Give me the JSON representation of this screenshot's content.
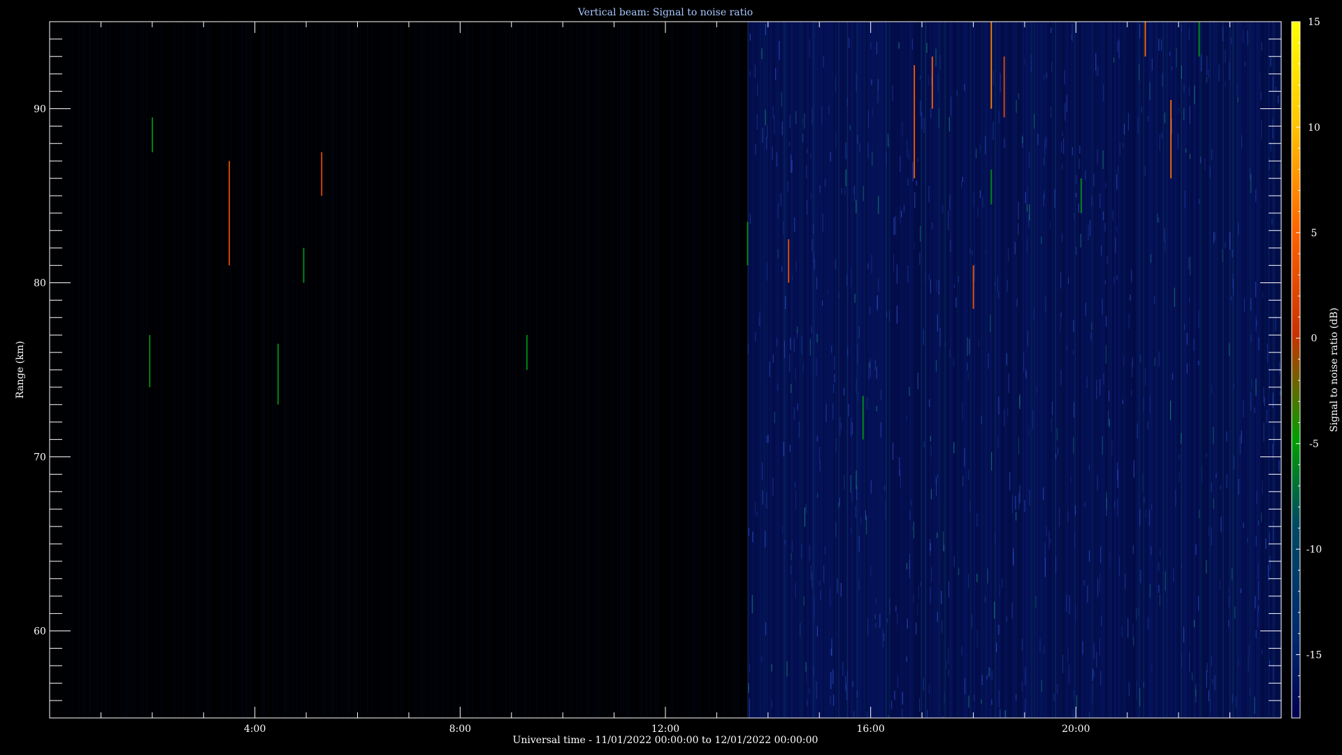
{
  "chart_data": {
    "type": "heatmap",
    "title": "Vertical beam: Signal to noise ratio",
    "xlabel": "Universal time - 11/01/2022 00:00:00 to 12/01/2022 00:00:00",
    "ylabel": "Range (km)",
    "colorbar_label": "Signal to noise ratio (dB)",
    "xlim_hours": [
      0,
      24
    ],
    "ylim_km": [
      55,
      95
    ],
    "clim_db": [
      -18,
      15
    ],
    "x_ticks": [
      {
        "hours": 4,
        "label": "4:00"
      },
      {
        "hours": 8,
        "label": "8:00"
      },
      {
        "hours": 12,
        "label": "12:00"
      },
      {
        "hours": 16,
        "label": "16:00"
      },
      {
        "hours": 20,
        "label": "20:00"
      }
    ],
    "y_ticks": [
      {
        "km": 60,
        "label": "60"
      },
      {
        "km": 70,
        "label": "70"
      },
      {
        "km": 80,
        "label": "80"
      },
      {
        "km": 90,
        "label": "90"
      }
    ],
    "colorbar_ticks": [
      {
        "db": 15,
        "label": "15"
      },
      {
        "db": 10,
        "label": "10"
      },
      {
        "db": 5,
        "label": "5"
      },
      {
        "db": 0,
        "label": "0"
      },
      {
        "db": -5,
        "label": "-5"
      },
      {
        "db": -10,
        "label": "-10"
      },
      {
        "db": -15,
        "label": "-15"
      }
    ],
    "colormap": [
      "#000050",
      "#003278",
      "#006446",
      "#00a000",
      "#c83200",
      "#ff6400",
      "#ffc800",
      "#ffff00"
    ],
    "background_regimes": [
      {
        "start_hours": 0,
        "end_hours": 13.6,
        "level": "low noise"
      },
      {
        "start_hours": 13.6,
        "end_hours": 24,
        "level": "elevated noise"
      }
    ],
    "features": [
      {
        "t_hours": 2.0,
        "range_km": [
          87.5,
          89.5
        ],
        "snr_db": -5
      },
      {
        "t_hours": 1.95,
        "range_km": [
          74,
          77
        ],
        "snr_db": -5
      },
      {
        "t_hours": 3.5,
        "range_km": [
          81,
          87
        ],
        "snr_db": 3
      },
      {
        "t_hours": 4.45,
        "range_km": [
          73,
          76.5
        ],
        "snr_db": -5
      },
      {
        "t_hours": 4.95,
        "range_km": [
          80,
          82
        ],
        "snr_db": -5
      },
      {
        "t_hours": 5.3,
        "range_km": [
          85,
          87.5
        ],
        "snr_db": 3
      },
      {
        "t_hours": 9.3,
        "range_km": [
          75,
          77
        ],
        "snr_db": -5
      },
      {
        "t_hours": 13.6,
        "range_km": [
          81,
          83.5
        ],
        "snr_db": -5
      },
      {
        "t_hours": 14.4,
        "range_km": [
          80,
          82.5
        ],
        "snr_db": 4
      },
      {
        "t_hours": 15.85,
        "range_km": [
          71,
          73.5
        ],
        "snr_db": -5
      },
      {
        "t_hours": 16.85,
        "range_km": [
          86,
          92.5
        ],
        "snr_db": 5
      },
      {
        "t_hours": 17.2,
        "range_km": [
          90,
          93
        ],
        "snr_db": 5
      },
      {
        "t_hours": 18.0,
        "range_km": [
          78.5,
          81
        ],
        "snr_db": 4
      },
      {
        "t_hours": 18.35,
        "range_km": [
          90,
          95
        ],
        "snr_db": 7
      },
      {
        "t_hours": 18.35,
        "range_km": [
          84.5,
          86.5
        ],
        "snr_db": -5
      },
      {
        "t_hours": 18.6,
        "range_km": [
          89.5,
          93
        ],
        "snr_db": 3
      },
      {
        "t_hours": 20.1,
        "range_km": [
          84,
          86
        ],
        "snr_db": -5
      },
      {
        "t_hours": 21.35,
        "range_km": [
          93,
          95
        ],
        "snr_db": 6
      },
      {
        "t_hours": 21.85,
        "range_km": [
          86,
          90.5
        ],
        "snr_db": 6
      },
      {
        "t_hours": 22.4,
        "range_km": [
          93,
          95
        ],
        "snr_db": -5
      }
    ]
  }
}
